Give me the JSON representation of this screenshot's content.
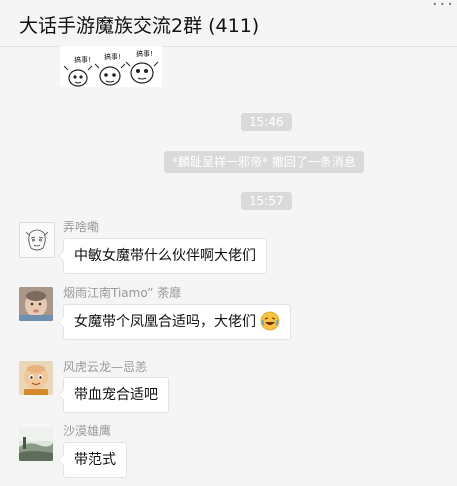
{
  "header": {
    "title": "大话手游魔族交流2群 (411)",
    "more_label": "···"
  },
  "sticker": {
    "label_1": "搞事!",
    "label_2": "搞事!",
    "label_3": "搞事!"
  },
  "timestamps": [
    "15:46",
    "15:57"
  ],
  "recall_notice": "*麟趾呈祥一邪帝* 撤回了一条消息",
  "messages": [
    {
      "sender": "弄啥嘞",
      "text": "中敏女魔带什么伙伴啊大佬们",
      "avatar": "sketch-face-avatar"
    },
    {
      "sender": "烟雨江南Tiamo” 荼靡",
      "text": "女魔带个凤凰合适吗，大佬们",
      "avatar": "baby-photo-avatar",
      "emoji": "laughing-emoji"
    },
    {
      "sender": "风虎云龙—忌恙",
      "text": "带血宠合适吧",
      "avatar": "cartoon-boy-avatar"
    },
    {
      "sender": "沙漠雄鹰",
      "text": "带范式",
      "avatar": "landscape-avatar"
    }
  ]
}
